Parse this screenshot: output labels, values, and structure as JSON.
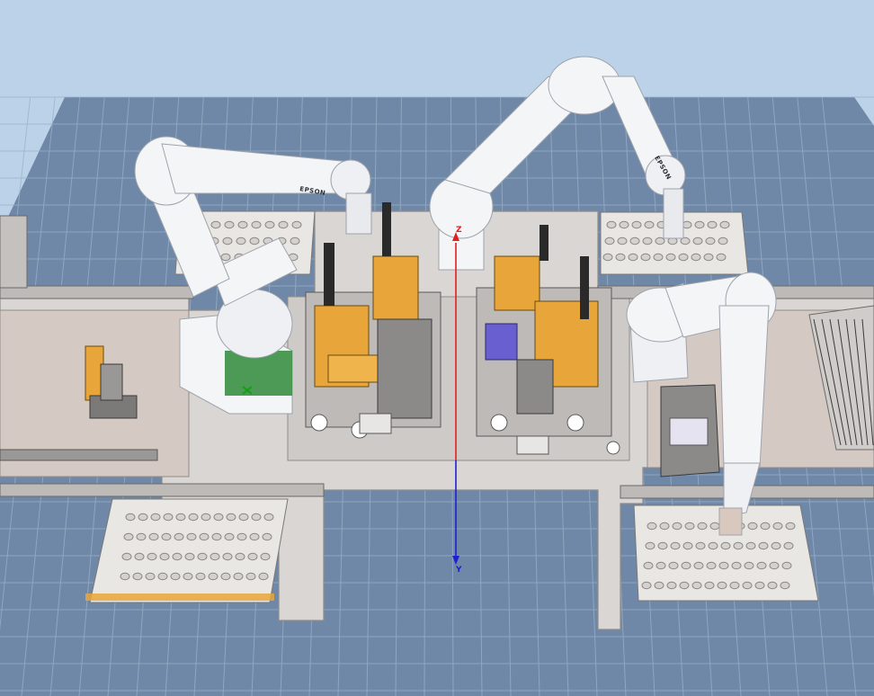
{
  "viewport": {
    "background": "#bcd2e8",
    "floor_color": "#6f88a8",
    "grid_line_color": "#9cb0c8"
  },
  "axes": {
    "z": {
      "label": "Z",
      "color": "#e02020"
    },
    "y": {
      "label": "Y",
      "color": "#2020d0"
    },
    "x": {
      "label": "X",
      "color": "#10a010"
    }
  },
  "robots": [
    {
      "id": "robot-1",
      "brand": "EPSON"
    },
    {
      "id": "robot-2",
      "brand": "EPSON"
    },
    {
      "id": "robot-3",
      "brand": ""
    }
  ],
  "colors": {
    "robot_body": "#f4f5f7",
    "robot_shade": "#c9ccd2",
    "plate": "#d9d6d4",
    "frame": "#c7c4c2",
    "tooling_orange": "#e8a63a",
    "tooling_dark": "#3a3a3a",
    "tray": "#e9e7e4",
    "accent_green": "#2f8a3a",
    "accent_purple": "#6a5fd0"
  }
}
